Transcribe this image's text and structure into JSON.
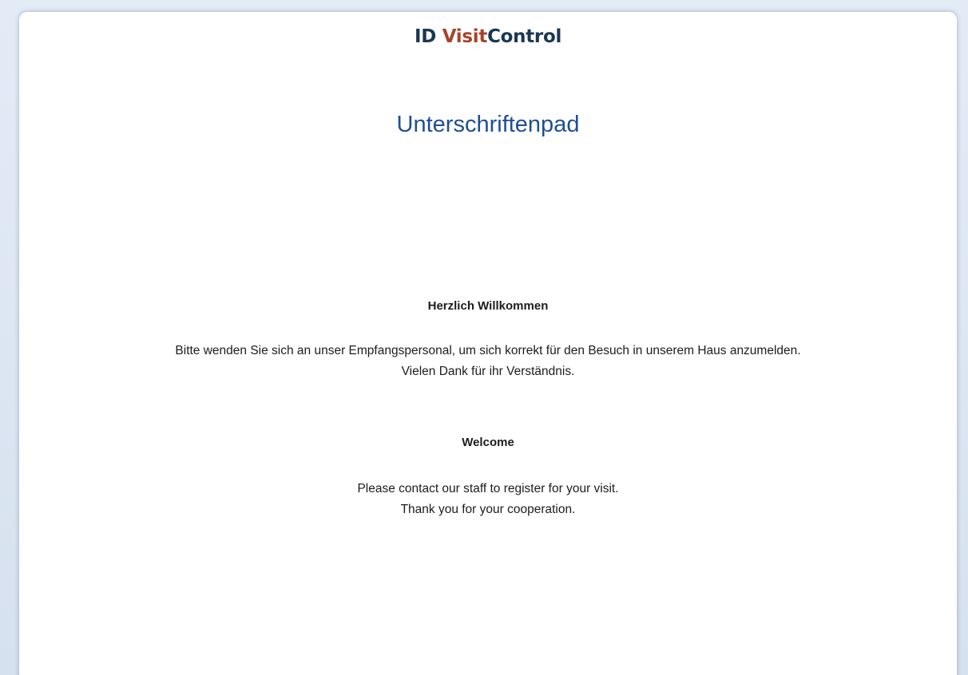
{
  "logo": {
    "id": "ID ",
    "visit": "Visit",
    "control": "Control",
    "colors": {
      "id": "#1a3752",
      "visit": "#a8432a",
      "control": "#1a3752"
    }
  },
  "title": "Unterschriftenpad",
  "german": {
    "heading": "Herzlich Willkommen",
    "line1": "Bitte wenden Sie sich an unser Empfangspersonal, um sich korrekt für den Besuch in unserem Haus anzumelden.",
    "line2": "Vielen Dank für ihr Verständnis."
  },
  "english": {
    "heading": "Welcome",
    "line1": "Please contact our staff to register for your visit.",
    "line2": "Thank you for your cooperation."
  },
  "colors": {
    "title": "#1f4e96",
    "text": "#1c1c1c",
    "background": "#dde6f2"
  }
}
